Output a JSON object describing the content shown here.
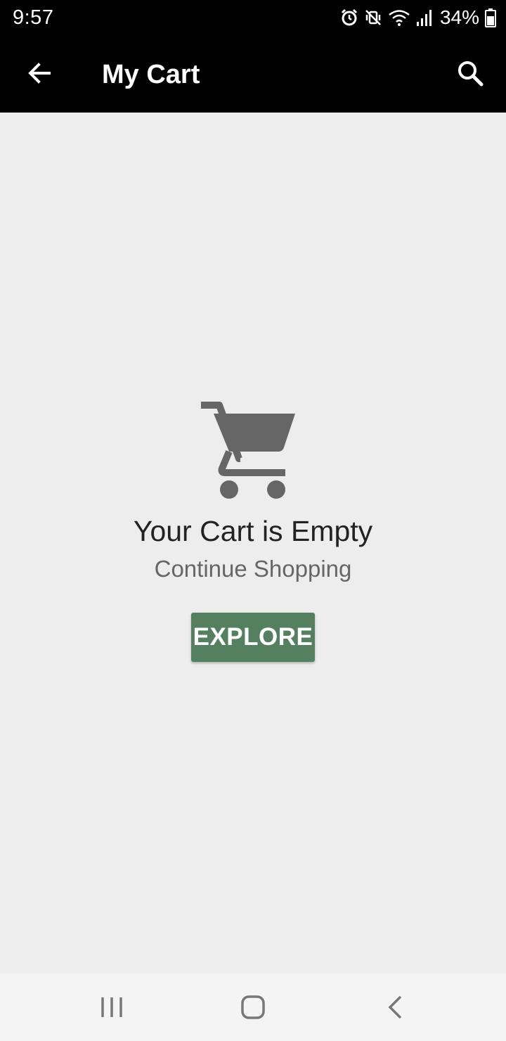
{
  "status_bar": {
    "time": "9:57",
    "battery_text": "34%",
    "icons": [
      "alarm-icon",
      "mute-vibrate-icon",
      "wifi-icon",
      "signal-icon",
      "battery-icon"
    ]
  },
  "app_bar": {
    "title": "My Cart",
    "back_icon": "arrow-left-icon",
    "search_icon": "search-icon"
  },
  "empty_state": {
    "icon": "shopping-cart-icon",
    "title": "Your Cart is Empty",
    "subtitle": "Continue Shopping",
    "button_label": "EXPLORE"
  },
  "nav_bar": {
    "icons": [
      "recents-icon",
      "home-icon",
      "back-icon"
    ]
  },
  "colors": {
    "app_bar_bg": "#000000",
    "content_bg": "#ededed",
    "button_bg": "#548060",
    "icon_gray": "#666666"
  }
}
